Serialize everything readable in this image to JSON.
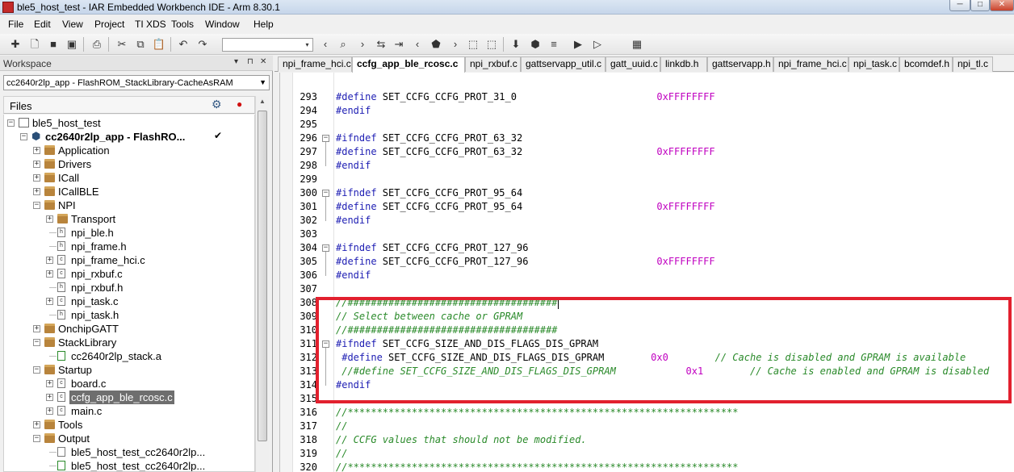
{
  "window": {
    "title": "ble5_host_test - IAR Embedded Workbench IDE - Arm 8.30.1",
    "min_label": "─",
    "max_label": "□",
    "close_label": "✕"
  },
  "menu": [
    "File",
    "Edit",
    "View",
    "Project",
    "TI XDS",
    "Tools",
    "Window",
    "Help"
  ],
  "toolbar": {
    "find_value": "",
    "find_arrow": "▾"
  },
  "workspace": {
    "title": "Workspace",
    "header_btns": [
      "▾",
      "⊓",
      "✕"
    ],
    "configuration": "cc2640r2lp_app - FlashROM_StackLibrary-CacheAsRAM",
    "config_arrow": "▼",
    "files_label": "Files",
    "gear_glyph": "⚙",
    "dot_glyph": "●",
    "scroll_up": "▲",
    "tree": [
      {
        "label": "ble5_host_test",
        "bold": false,
        "exp": "−",
        "icon": "project"
      },
      {
        "label": "cc2640r2lp_app - FlashRO...",
        "bold": true,
        "exp": "−",
        "icon": "cube",
        "check": "✔"
      },
      {
        "label": "Application",
        "exp": "+",
        "icon": "folder"
      },
      {
        "label": "Drivers",
        "exp": "+",
        "icon": "folder"
      },
      {
        "label": "ICall",
        "exp": "+",
        "icon": "folder"
      },
      {
        "label": "ICallBLE",
        "exp": "+",
        "icon": "folder"
      },
      {
        "label": "NPI",
        "exp": "−",
        "icon": "folder"
      },
      {
        "label": "Transport",
        "exp": "+",
        "icon": "folder"
      },
      {
        "label": "npi_ble.h",
        "exp": "",
        "icon": "file",
        "glyph": "h"
      },
      {
        "label": "npi_frame.h",
        "exp": "",
        "icon": "file",
        "glyph": "h"
      },
      {
        "label": "npi_frame_hci.c",
        "exp": "+",
        "icon": "file",
        "glyph": "c"
      },
      {
        "label": "npi_rxbuf.c",
        "exp": "+",
        "icon": "file",
        "glyph": "c"
      },
      {
        "label": "npi_rxbuf.h",
        "exp": "",
        "icon": "file",
        "glyph": "h"
      },
      {
        "label": "npi_task.c",
        "exp": "+",
        "icon": "file",
        "glyph": "c"
      },
      {
        "label": "npi_task.h",
        "exp": "",
        "icon": "file",
        "glyph": "h"
      },
      {
        "label": "OnchipGATT",
        "exp": "+",
        "icon": "folder"
      },
      {
        "label": "StackLibrary",
        "exp": "−",
        "icon": "folder"
      },
      {
        "label": "cc2640r2lp_stack.a",
        "exp": "",
        "icon": "lib"
      },
      {
        "label": "Startup",
        "exp": "−",
        "icon": "folder"
      },
      {
        "label": "board.c",
        "exp": "+",
        "icon": "file",
        "glyph": "c"
      },
      {
        "label": "ccfg_app_ble_rcosc.c",
        "exp": "+",
        "icon": "file",
        "glyph": "c",
        "selected": true
      },
      {
        "label": "main.c",
        "exp": "+",
        "icon": "file",
        "glyph": "c"
      },
      {
        "label": "Tools",
        "exp": "+",
        "icon": "folder"
      },
      {
        "label": "Output",
        "exp": "−",
        "icon": "folder"
      },
      {
        "label": "ble5_host_test_cc2640r2lp...",
        "exp": "",
        "icon": "file",
        "glyph": ""
      },
      {
        "label": "ble5_host_test_cc2640r2lp...",
        "exp": "",
        "icon": "lib"
      }
    ]
  },
  "tabs": [
    {
      "label": "npi_frame_hci.c",
      "active": false
    },
    {
      "label": "ccfg_app_ble_rcosc.c",
      "active": true,
      "close": "x"
    },
    {
      "label": "npi_rxbuf.c",
      "active": false
    },
    {
      "label": "gattservapp_util.c",
      "active": false
    },
    {
      "label": "gatt_uuid.c",
      "active": false
    },
    {
      "label": "linkdb.h",
      "active": false
    },
    {
      "label": "gattservapp.h",
      "active": false
    },
    {
      "label": "npi_frame_hci.c",
      "active": false
    },
    {
      "label": "npi_task.c",
      "active": false
    },
    {
      "label": "bcomdef.h",
      "active": false
    },
    {
      "label": "npi_tl.c",
      "active": false
    }
  ],
  "code": [
    {
      "n": "293",
      "parts": [
        [
          "kw",
          "#define "
        ],
        [
          "id",
          "SET_CCFG_CCFG_PROT_31_0"
        ],
        [
          "sp",
          "                        "
        ],
        [
          "num",
          "0xFFFFFFFF"
        ]
      ]
    },
    {
      "n": "294",
      "parts": [
        [
          "kw",
          "#endif"
        ]
      ]
    },
    {
      "n": "295",
      "parts": []
    },
    {
      "n": "296",
      "fold": "−",
      "parts": [
        [
          "kw",
          "#ifndef "
        ],
        [
          "id",
          "SET_CCFG_CCFG_PROT_63_32"
        ]
      ]
    },
    {
      "n": "297",
      "parts": [
        [
          "kw",
          "#define "
        ],
        [
          "id",
          "SET_CCFG_CCFG_PROT_63_32"
        ],
        [
          "sp",
          "                       "
        ],
        [
          "num",
          "0xFFFFFFFF"
        ]
      ]
    },
    {
      "n": "298",
      "parts": [
        [
          "kw",
          "#endif"
        ]
      ]
    },
    {
      "n": "299",
      "parts": []
    },
    {
      "n": "300",
      "fold": "−",
      "parts": [
        [
          "kw",
          "#ifndef "
        ],
        [
          "id",
          "SET_CCFG_CCFG_PROT_95_64"
        ]
      ]
    },
    {
      "n": "301",
      "parts": [
        [
          "kw",
          "#define "
        ],
        [
          "id",
          "SET_CCFG_CCFG_PROT_95_64"
        ],
        [
          "sp",
          "                       "
        ],
        [
          "num",
          "0xFFFFFFFF"
        ]
      ]
    },
    {
      "n": "302",
      "parts": [
        [
          "kw",
          "#endif"
        ]
      ]
    },
    {
      "n": "303",
      "parts": []
    },
    {
      "n": "304",
      "fold": "−",
      "parts": [
        [
          "kw",
          "#ifndef "
        ],
        [
          "id",
          "SET_CCFG_CCFG_PROT_127_96"
        ]
      ]
    },
    {
      "n": "305",
      "parts": [
        [
          "kw",
          "#define "
        ],
        [
          "id",
          "SET_CCFG_CCFG_PROT_127_96"
        ],
        [
          "sp",
          "                      "
        ],
        [
          "num",
          "0xFFFFFFFF"
        ]
      ]
    },
    {
      "n": "306",
      "parts": [
        [
          "kw",
          "#endif"
        ]
      ]
    },
    {
      "n": "307",
      "parts": []
    },
    {
      "n": "308",
      "parts": [
        [
          "cm",
          "//####################################"
        ]
      ],
      "caret": true
    },
    {
      "n": "309",
      "parts": [
        [
          "cm",
          "// Select between cache or GPRAM"
        ]
      ]
    },
    {
      "n": "310",
      "parts": [
        [
          "cm",
          "//####################################"
        ]
      ]
    },
    {
      "n": "311",
      "fold": "−",
      "parts": [
        [
          "kw",
          "#ifndef "
        ],
        [
          "id",
          "SET_CCFG_SIZE_AND_DIS_FLAGS_DIS_GPRAM"
        ]
      ]
    },
    {
      "n": "312",
      "parts": [
        [
          "sp",
          " "
        ],
        [
          "kw",
          "#define "
        ],
        [
          "id",
          "SET_CCFG_SIZE_AND_DIS_FLAGS_DIS_GPRAM"
        ],
        [
          "sp",
          "        "
        ],
        [
          "num",
          "0x0"
        ],
        [
          "sp",
          "        "
        ],
        [
          "cm",
          "// Cache is disabled and GPRAM is available"
        ]
      ]
    },
    {
      "n": "313",
      "parts": [
        [
          "sp",
          " "
        ],
        [
          "cm",
          "//#define SET_CCFG_SIZE_AND_DIS_FLAGS_DIS_GPRAM"
        ],
        [
          "sp",
          "            "
        ],
        [
          "num",
          "0x1"
        ],
        [
          "sp",
          "        "
        ],
        [
          "cm",
          "// Cache is enabled and GPRAM is disabled"
        ]
      ]
    },
    {
      "n": "314",
      "parts": [
        [
          "kw",
          "#endif"
        ]
      ]
    },
    {
      "n": "315",
      "parts": []
    },
    {
      "n": "316",
      "parts": [
        [
          "cm",
          "//*******************************************************************"
        ]
      ]
    },
    {
      "n": "317",
      "parts": [
        [
          "cm",
          "//"
        ]
      ]
    },
    {
      "n": "318",
      "parts": [
        [
          "cm",
          "// CCFG values that should not be modified."
        ]
      ]
    },
    {
      "n": "319",
      "parts": [
        [
          "cm",
          "//"
        ]
      ]
    },
    {
      "n": "320",
      "parts": [
        [
          "cm",
          "//*******************************************************************"
        ]
      ]
    }
  ],
  "colors": {
    "keyword": "#1d1db3",
    "number": "#c000c0",
    "comment": "#2a8a2a",
    "highlight": "#e2202e"
  }
}
